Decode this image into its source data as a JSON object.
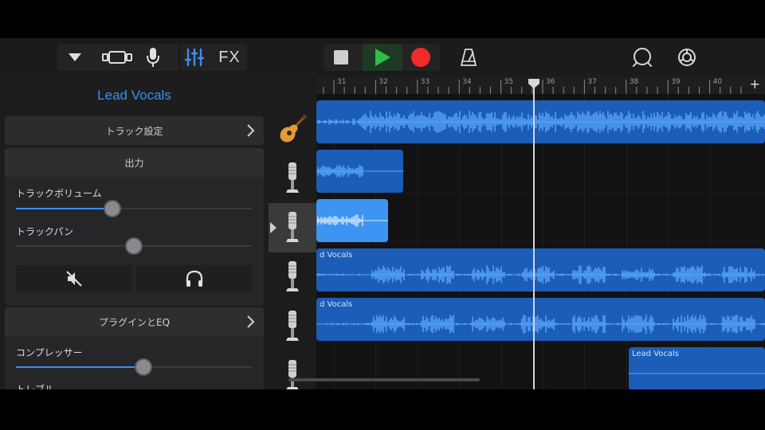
{
  "toolbar": {
    "dropdown_icon": "triangle-down-icon",
    "view_icon": "track-view-icon",
    "mic_icon": "microphone-icon",
    "mixer_icon": "mixer-icon",
    "fx_label": "FX",
    "stop_icon": "stop-icon",
    "play_icon": "play-icon",
    "record_icon": "record-icon",
    "metronome_icon": "metronome-icon",
    "loop_icon": "loop-icon",
    "settings_icon": "settings-icon",
    "colors": {
      "play": "#2fbe4a",
      "record": "#f02b2b",
      "accent": "#3d8ff0"
    }
  },
  "panel": {
    "title": "Lead Vocals",
    "track_settings": "トラック設定",
    "output": {
      "header": "出力",
      "volume_label": "トラックボリューム",
      "volume_value": 0.41,
      "pan_label": "トラックパン",
      "pan_value": 0.5
    },
    "plugins": {
      "header": "プラグインとEQ",
      "compressor_label": "コンプレッサー",
      "compressor_value": 0.54,
      "treble_label": "トレブル"
    }
  },
  "tracks": [
    {
      "icon": "acoustic-guitar-icon",
      "selected": false
    },
    {
      "icon": "microphone-icon",
      "selected": false
    },
    {
      "icon": "microphone-icon",
      "selected": true
    },
    {
      "icon": "microphone-icon",
      "selected": false
    },
    {
      "icon": "microphone-icon",
      "selected": false
    },
    {
      "icon": "microphone-icon",
      "selected": false
    }
  ],
  "ruler": {
    "bars": [
      "31",
      "32",
      "33",
      "34",
      "35",
      "36",
      "37",
      "38",
      "39",
      "40"
    ],
    "add_icon": "+"
  },
  "regions": [
    {
      "name": "",
      "lane": 0
    },
    {
      "name": "",
      "lane": 1
    },
    {
      "name": "",
      "lane": 2
    },
    {
      "name": "d Vocals",
      "lane": 3
    },
    {
      "name": "d Vocals",
      "lane": 4
    },
    {
      "name": "Lead Vocals",
      "lane": 5
    }
  ]
}
